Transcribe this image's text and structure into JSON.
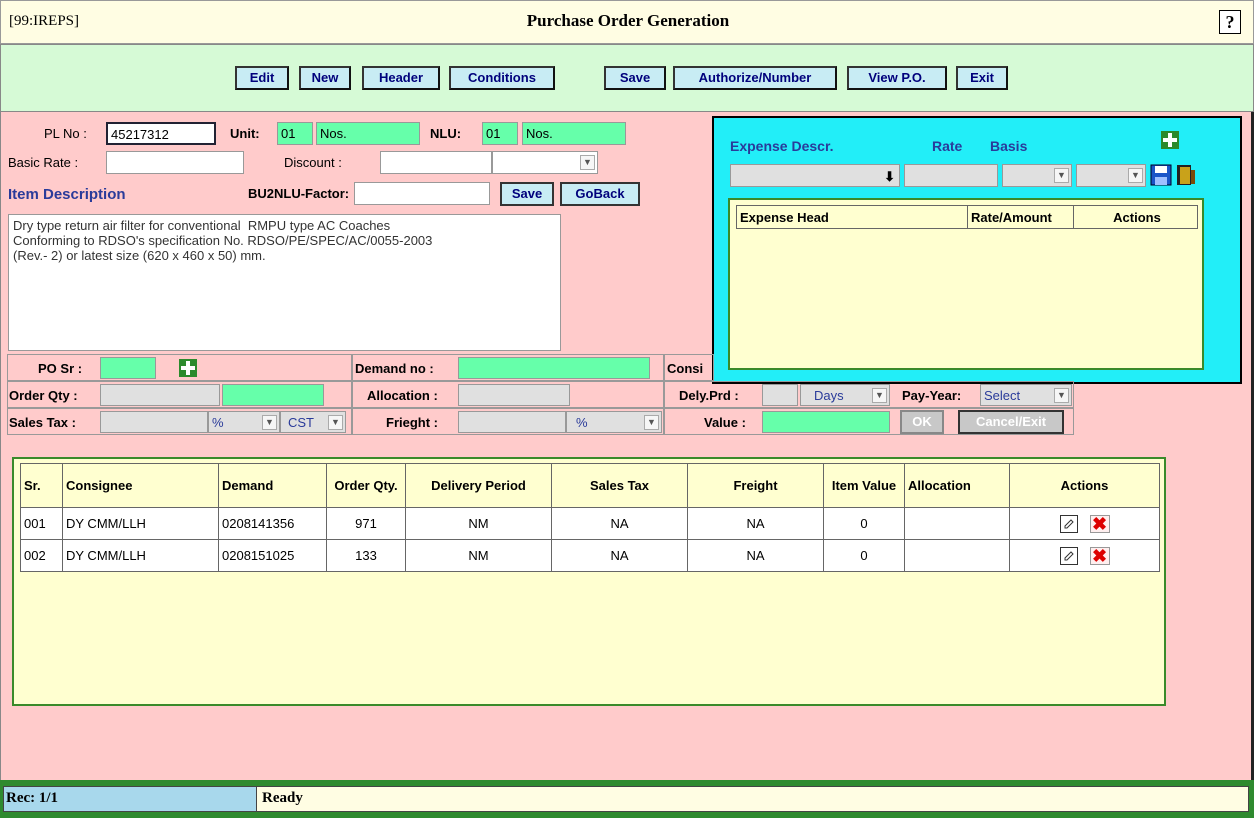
{
  "app_id": "[99:IREPS]",
  "title": "Purchase Order Generation",
  "help_label": "?",
  "toolbar": {
    "edit": "Edit",
    "new": "New",
    "header": "Header",
    "conditions": "Conditions",
    "save": "Save",
    "authorize": "Authorize/Number",
    "view_po": "View P.O.",
    "exit": "Exit"
  },
  "item": {
    "pl_no_label": "PL No :",
    "pl_no": "45217312",
    "unit_label": "Unit:",
    "unit_code": "01",
    "unit_name": "Nos.",
    "nlu_label": "NLU:",
    "nlu_code": "01",
    "nlu_name": "Nos.",
    "basic_rate_label": "Basic Rate :",
    "basic_rate": "",
    "discount_label": "Discount :",
    "discount": "",
    "discount_type": "",
    "item_desc_label": "Item Description",
    "bu2nlu_label": "BU2NLU-Factor:",
    "bu2nlu": "",
    "save": "Save",
    "goback": "GoBack",
    "description": "Dry type return air filter for conventional  RMPU type AC Coaches\nConforming to RDSO's specification No. RDSO/PE/SPEC/AC/0055-2003\n(Rev.- 2) or latest size (620 x 460 x 50) mm."
  },
  "expense": {
    "descr_label": "Expense Descr.",
    "rate_label": "Rate",
    "basis_label": "Basis",
    "columns": [
      "Expense Head",
      "Rate/Amount",
      "Actions"
    ]
  },
  "po_form": {
    "po_sr_label": "PO Sr :",
    "po_sr": "",
    "demand_label": "Demand no :",
    "demand": "",
    "consignee_label": "Consi",
    "order_qty_label": "Order Qty :",
    "allocation_label": "Allocation :",
    "dely_prd_label": "Dely.Prd :",
    "dely_unit": "Days",
    "pay_year_label": "Pay-Year:",
    "pay_year": "Select",
    "sales_tax_label": "Sales Tax :",
    "sales_tax_unit": "%",
    "sales_tax_type": "CST",
    "freight_label": "Frieght :",
    "freight_unit": "%",
    "value_label": "Value :",
    "ok": "OK",
    "cancel_exit": "Cancel/Exit"
  },
  "table": {
    "columns": [
      "Sr.",
      "Consignee",
      "Demand",
      "Order Qty.",
      "Delivery Period",
      "Sales Tax",
      "Freight",
      "Item Value",
      "Allocation",
      "Actions"
    ],
    "rows": [
      {
        "sr": "001",
        "consignee": "DY CMM/LLH",
        "demand": "0208141356",
        "qty": "971",
        "delivery": "NM",
        "sales_tax": "NA",
        "freight": "NA",
        "value": "0",
        "allocation": ""
      },
      {
        "sr": "002",
        "consignee": "DY CMM/LLH",
        "demand": "0208151025",
        "qty": "133",
        "delivery": "NM",
        "sales_tax": "NA",
        "freight": "NA",
        "value": "0",
        "allocation": ""
      }
    ]
  },
  "status": {
    "rec": "Rec: 1/1",
    "message": "Ready"
  },
  "colors": {
    "pink_panel": "#ffcbcb",
    "toolbar_green": "#d6fad6",
    "expense_cyan": "#22eef8",
    "input_green": "#66ffaa",
    "button_text": "#00007c"
  }
}
